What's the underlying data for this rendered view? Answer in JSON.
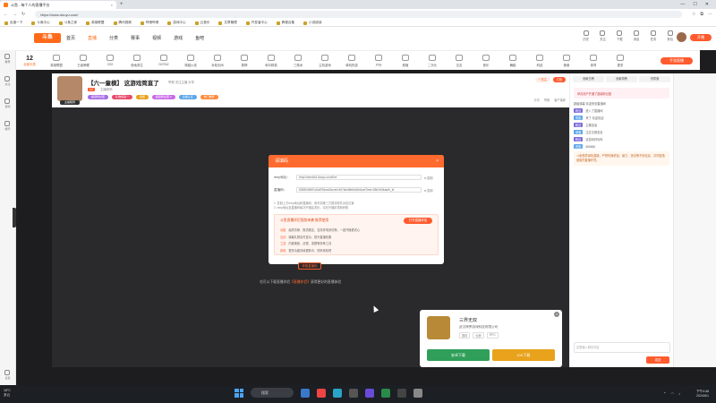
{
  "browser": {
    "tab_title": "斗鱼 - 每个人的直播平台",
    "url": "https://www.douyu.com/",
    "bookmarks": [
      "百度一下",
      "斗鱼中心",
      "斗鱼之家",
      "英雄联盟",
      "腾讯视频",
      "哔哩哔哩",
      "游戏中心",
      "云音乐",
      "文章管理",
      "开发者中心",
      "教程合集",
      "小说阅读"
    ]
  },
  "site": {
    "logo": "斗鱼",
    "nav": [
      "首页",
      "直播",
      "分类",
      "赛事",
      "视频",
      "游戏",
      "鱼吧"
    ],
    "active_nav": "直播",
    "header_icons": [
      "历史",
      "关注",
      "下载",
      "消息",
      "任务",
      "背包"
    ],
    "start_live": "开播",
    "categories_first": {
      "num": "12",
      "label": "全部分类"
    },
    "categories": [
      "英雄联盟",
      "王者荣耀",
      "CS2",
      "绝地求生",
      "DOTA2",
      "穿越火线",
      "永劫无间",
      "原神",
      "和平精英",
      "三角洲",
      "主机游戏",
      "单机热游",
      "户外",
      "颜值",
      "二次元",
      "交友",
      "音乐",
      "舞蹈",
      "科技",
      "美食",
      "体育",
      "更多"
    ],
    "play_button": "手游直播"
  },
  "sidebar": {
    "items": [
      "推荐",
      "关注",
      "游戏",
      "娱乐"
    ],
    "bottom": "设置"
  },
  "room": {
    "title": "【六一童模】 这游戏简直了",
    "note": "举报  关注主播  分享",
    "level": "LV",
    "anchor_name": "主播昵称",
    "badges": [
      "超级粉丝团",
      "礼物榜第一",
      "贵族",
      "超级粉丝团 5",
      "主播认证",
      "热门推荐"
    ],
    "right_buttons": [
      "+ 关注",
      "订阅"
    ],
    "tools": [
      "分享",
      "举报",
      "客户端看"
    ]
  },
  "modal": {
    "title": "请填码",
    "rtmp_label": "rtmp地址：",
    "rtmp_value": "rtmp://sendtc3.douyu.com/live",
    "key_label": "直播码：",
    "key_value": "5268049d91c0a57f&wsSecret=5d7a0c8fe6dd1b&wsTime=65e1b0&auth_id",
    "copy": "复制",
    "tips": [
      "1. 复制上方rtmp地址和直播码，填写到第三方推流软件对应位置",
      "2. rtmp地址及直播码每次开播会变化，请在开播前重新获取"
    ],
    "promo_title": "斗鱼直播伴侣强势来袭  推荐使用",
    "promo_button": "打开直播伴侣",
    "promo_lines": [
      {
        "tag": "功能",
        "text": "画质清晰、推流稳定，支持多场景切换，一键开播更省心"
      },
      {
        "tag": "互动",
        "text": "弹幕礼物实时显示，提升直播效果"
      },
      {
        "tag": "工具",
        "text": "内置美颜、滤镜、录屏等多种工具"
      },
      {
        "tag": "其他",
        "text": "更多功能持续更新中，快来体验吧"
      }
    ],
    "upgrade": "获取直播码"
  },
  "video": {
    "below_prefix": "也可以下载直播伴侣",
    "below_link": "【直播伴侣】",
    "below_suffix": "获得更好的直播体验"
  },
  "gamecard": {
    "name": "三界无双",
    "company": "武汉神罗游戏科技有限公司",
    "tags": [
      "国风",
      "仙侠",
      "RPG"
    ],
    "btn_download": "安卓下载",
    "btn_ios": "iOS下载"
  },
  "rightpanel": {
    "tabs": [
      "贡献日榜",
      "贡献周榜",
      "贵宾席"
    ],
    "lines": [
      {
        "kind": "pink",
        "text": "恭喜用户开通了超级粉丝团"
      },
      {
        "kind": "plain",
        "text": "超级弹幕  欢迎来到直播间"
      },
      {
        "kind": "tag",
        "tag": "粉丝",
        "text": "进入了直播间"
      },
      {
        "kind": "tag2",
        "tag": "贵族",
        "text": "来了 欢迎欢迎"
      },
      {
        "kind": "tag",
        "tag": "粉丝",
        "text": "主播加油"
      },
      {
        "kind": "tag2",
        "tag": "房管",
        "text": "注意文明发言"
      },
      {
        "kind": "tag",
        "tag": "粉丝",
        "text": "这游戏好玩吗"
      },
      {
        "kind": "tag2",
        "tag": "贵族",
        "text": "666666"
      }
    ],
    "notice": "斗鱼倡导绿色直播，严禁传播低俗、暴力、违法等不良信息，共同营造健康的直播环境。",
    "input_placeholder": "这里输入聊天内容",
    "send": "发送"
  },
  "taskbar": {
    "weather_temp": "18°C",
    "weather_desc": "多云",
    "search": "搜索",
    "time": "下午4:48",
    "date": "2024/6/1"
  },
  "colors": {
    "accent": "#ff6a2e",
    "video_bg": "#2a2a2c",
    "green_button": "#2f9f5a",
    "gold_button": "#e8a21b"
  }
}
